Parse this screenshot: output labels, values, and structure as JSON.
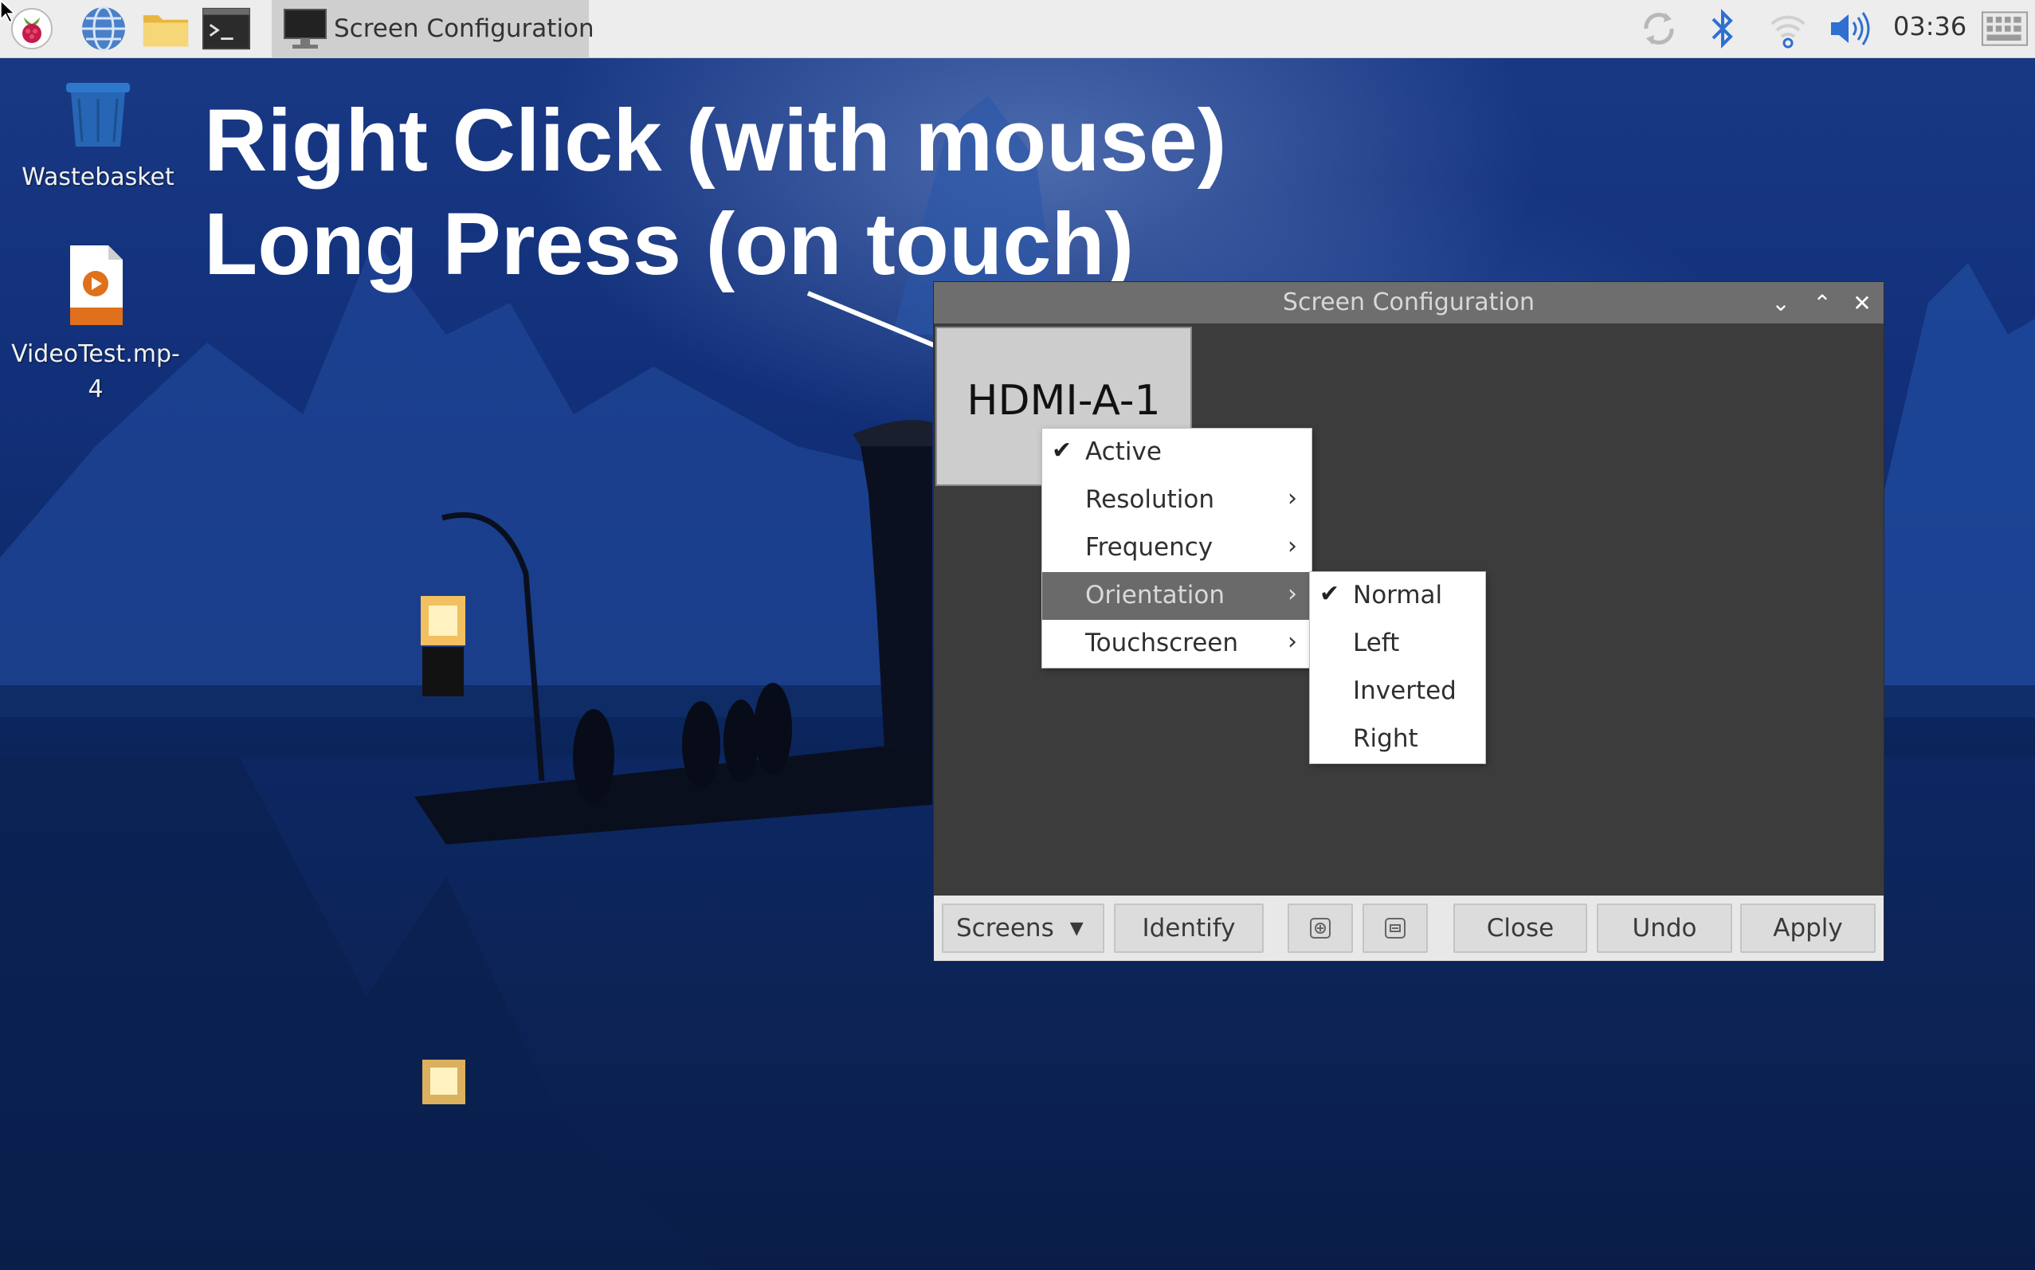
{
  "taskbar": {
    "launchers": [
      "raspberry-menu-icon",
      "web-browser-icon",
      "file-manager-icon",
      "terminal-icon"
    ],
    "task_title": "Screen Configuration",
    "tray": [
      "sync-icon",
      "bluetooth-icon",
      "wifi-icon",
      "volume-icon"
    ],
    "clock": "03:36",
    "keyboard_icon": "keyboard-icon"
  },
  "desktop": {
    "icons": [
      {
        "label": "Wastebasket",
        "icon": "trash-icon"
      },
      {
        "label": "VideoTest.mp-4",
        "icon": "video-file-icon"
      }
    ]
  },
  "annotation": {
    "line1": "Right Click (with mouse)",
    "line2": "Long Press (on touch)"
  },
  "window": {
    "title": "Screen Configuration",
    "controls": [
      "minimize",
      "maximize",
      "close"
    ],
    "monitor_label": "HDMI-A-1",
    "buttons": {
      "screens": "Screens",
      "identify": "Identify",
      "close": "Close",
      "undo": "Undo",
      "apply": "Apply"
    }
  },
  "context_menu": {
    "items": [
      {
        "label": "Active",
        "checked": true,
        "submenu": false
      },
      {
        "label": "Resolution",
        "checked": false,
        "submenu": true
      },
      {
        "label": "Frequency",
        "checked": false,
        "submenu": true
      },
      {
        "label": "Orientation",
        "checked": false,
        "submenu": true,
        "highlighted": true
      },
      {
        "label": "Touchscreen",
        "checked": false,
        "submenu": true
      }
    ]
  },
  "orientation_submenu": {
    "items": [
      {
        "label": "Normal",
        "checked": true
      },
      {
        "label": "Left",
        "checked": false
      },
      {
        "label": "Inverted",
        "checked": false
      },
      {
        "label": "Right",
        "checked": false
      }
    ]
  },
  "colors": {
    "taskbar": "#ededed",
    "titlebar": "#6e6e6e",
    "window_bg": "#3c3c3c",
    "menu_highlight": "#6a6a6a"
  }
}
